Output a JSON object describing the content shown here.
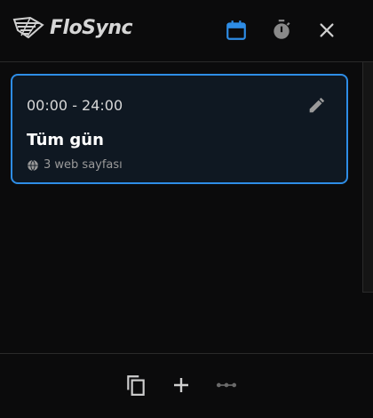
{
  "app": {
    "name": "FloSync"
  },
  "header": {
    "icons": {
      "calendar": "calendar-icon",
      "timer": "timer-icon",
      "close": "close-icon"
    },
    "active_color": "#2e8de6"
  },
  "schedule": {
    "items": [
      {
        "time_range": "00:00 - 24:00",
        "title": "Tüm gün",
        "sites": "3 web sayfası"
      }
    ]
  },
  "footer": {
    "icons": [
      "copy-icon",
      "add-icon",
      "more-icon"
    ]
  }
}
